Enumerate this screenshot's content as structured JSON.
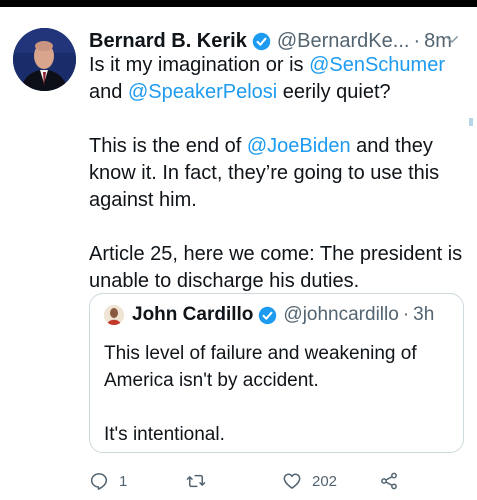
{
  "tweet": {
    "author_name": "Bernard B. Kerik",
    "handle": "@BernardKe...",
    "separator": "·",
    "time": "8m",
    "lines": [
      {
        "type": "mixed",
        "parts": [
          {
            "t": "Is it my imagination or is ",
            "m": false
          },
          {
            "t": "@SenSchumer",
            "m": true
          },
          {
            "t": " and ",
            "m": false
          },
          {
            "t": "@SpeakerPelosi",
            "m": true
          },
          {
            "t": " eerily quiet?",
            "m": false
          }
        ]
      },
      {
        "type": "gap"
      },
      {
        "type": "mixed",
        "parts": [
          {
            "t": "This is the end of ",
            "m": false
          },
          {
            "t": "@JoeBiden",
            "m": true
          },
          {
            "t": " and they know it. In fact, they’re going to use this against him.",
            "m": false
          }
        ]
      },
      {
        "type": "gap"
      },
      {
        "type": "mixed",
        "parts": [
          {
            "t": "Article 25, here we come: The president is unable to discharge his duties.",
            "m": false
          }
        ]
      }
    ],
    "quote": {
      "author_name": "John Cardillo",
      "handle": "@johncardillo",
      "separator": "·",
      "time": "3h",
      "text_line1": "This level of failure and weakening of America isn't by accident.",
      "text_line2": "It's intentional."
    },
    "actions": {
      "reply_count": "1",
      "retweet_count": "",
      "like_count": "202"
    },
    "icons": {
      "verified": "verified-badge-icon",
      "chevron": "chevron-down-icon",
      "reply": "reply-icon",
      "retweet": "retweet-icon",
      "like": "heart-icon",
      "share": "share-icon"
    },
    "colors": {
      "accent": "#1d9bf0",
      "muted": "#536471",
      "text": "#0f1419",
      "border": "#cfd9de"
    }
  }
}
